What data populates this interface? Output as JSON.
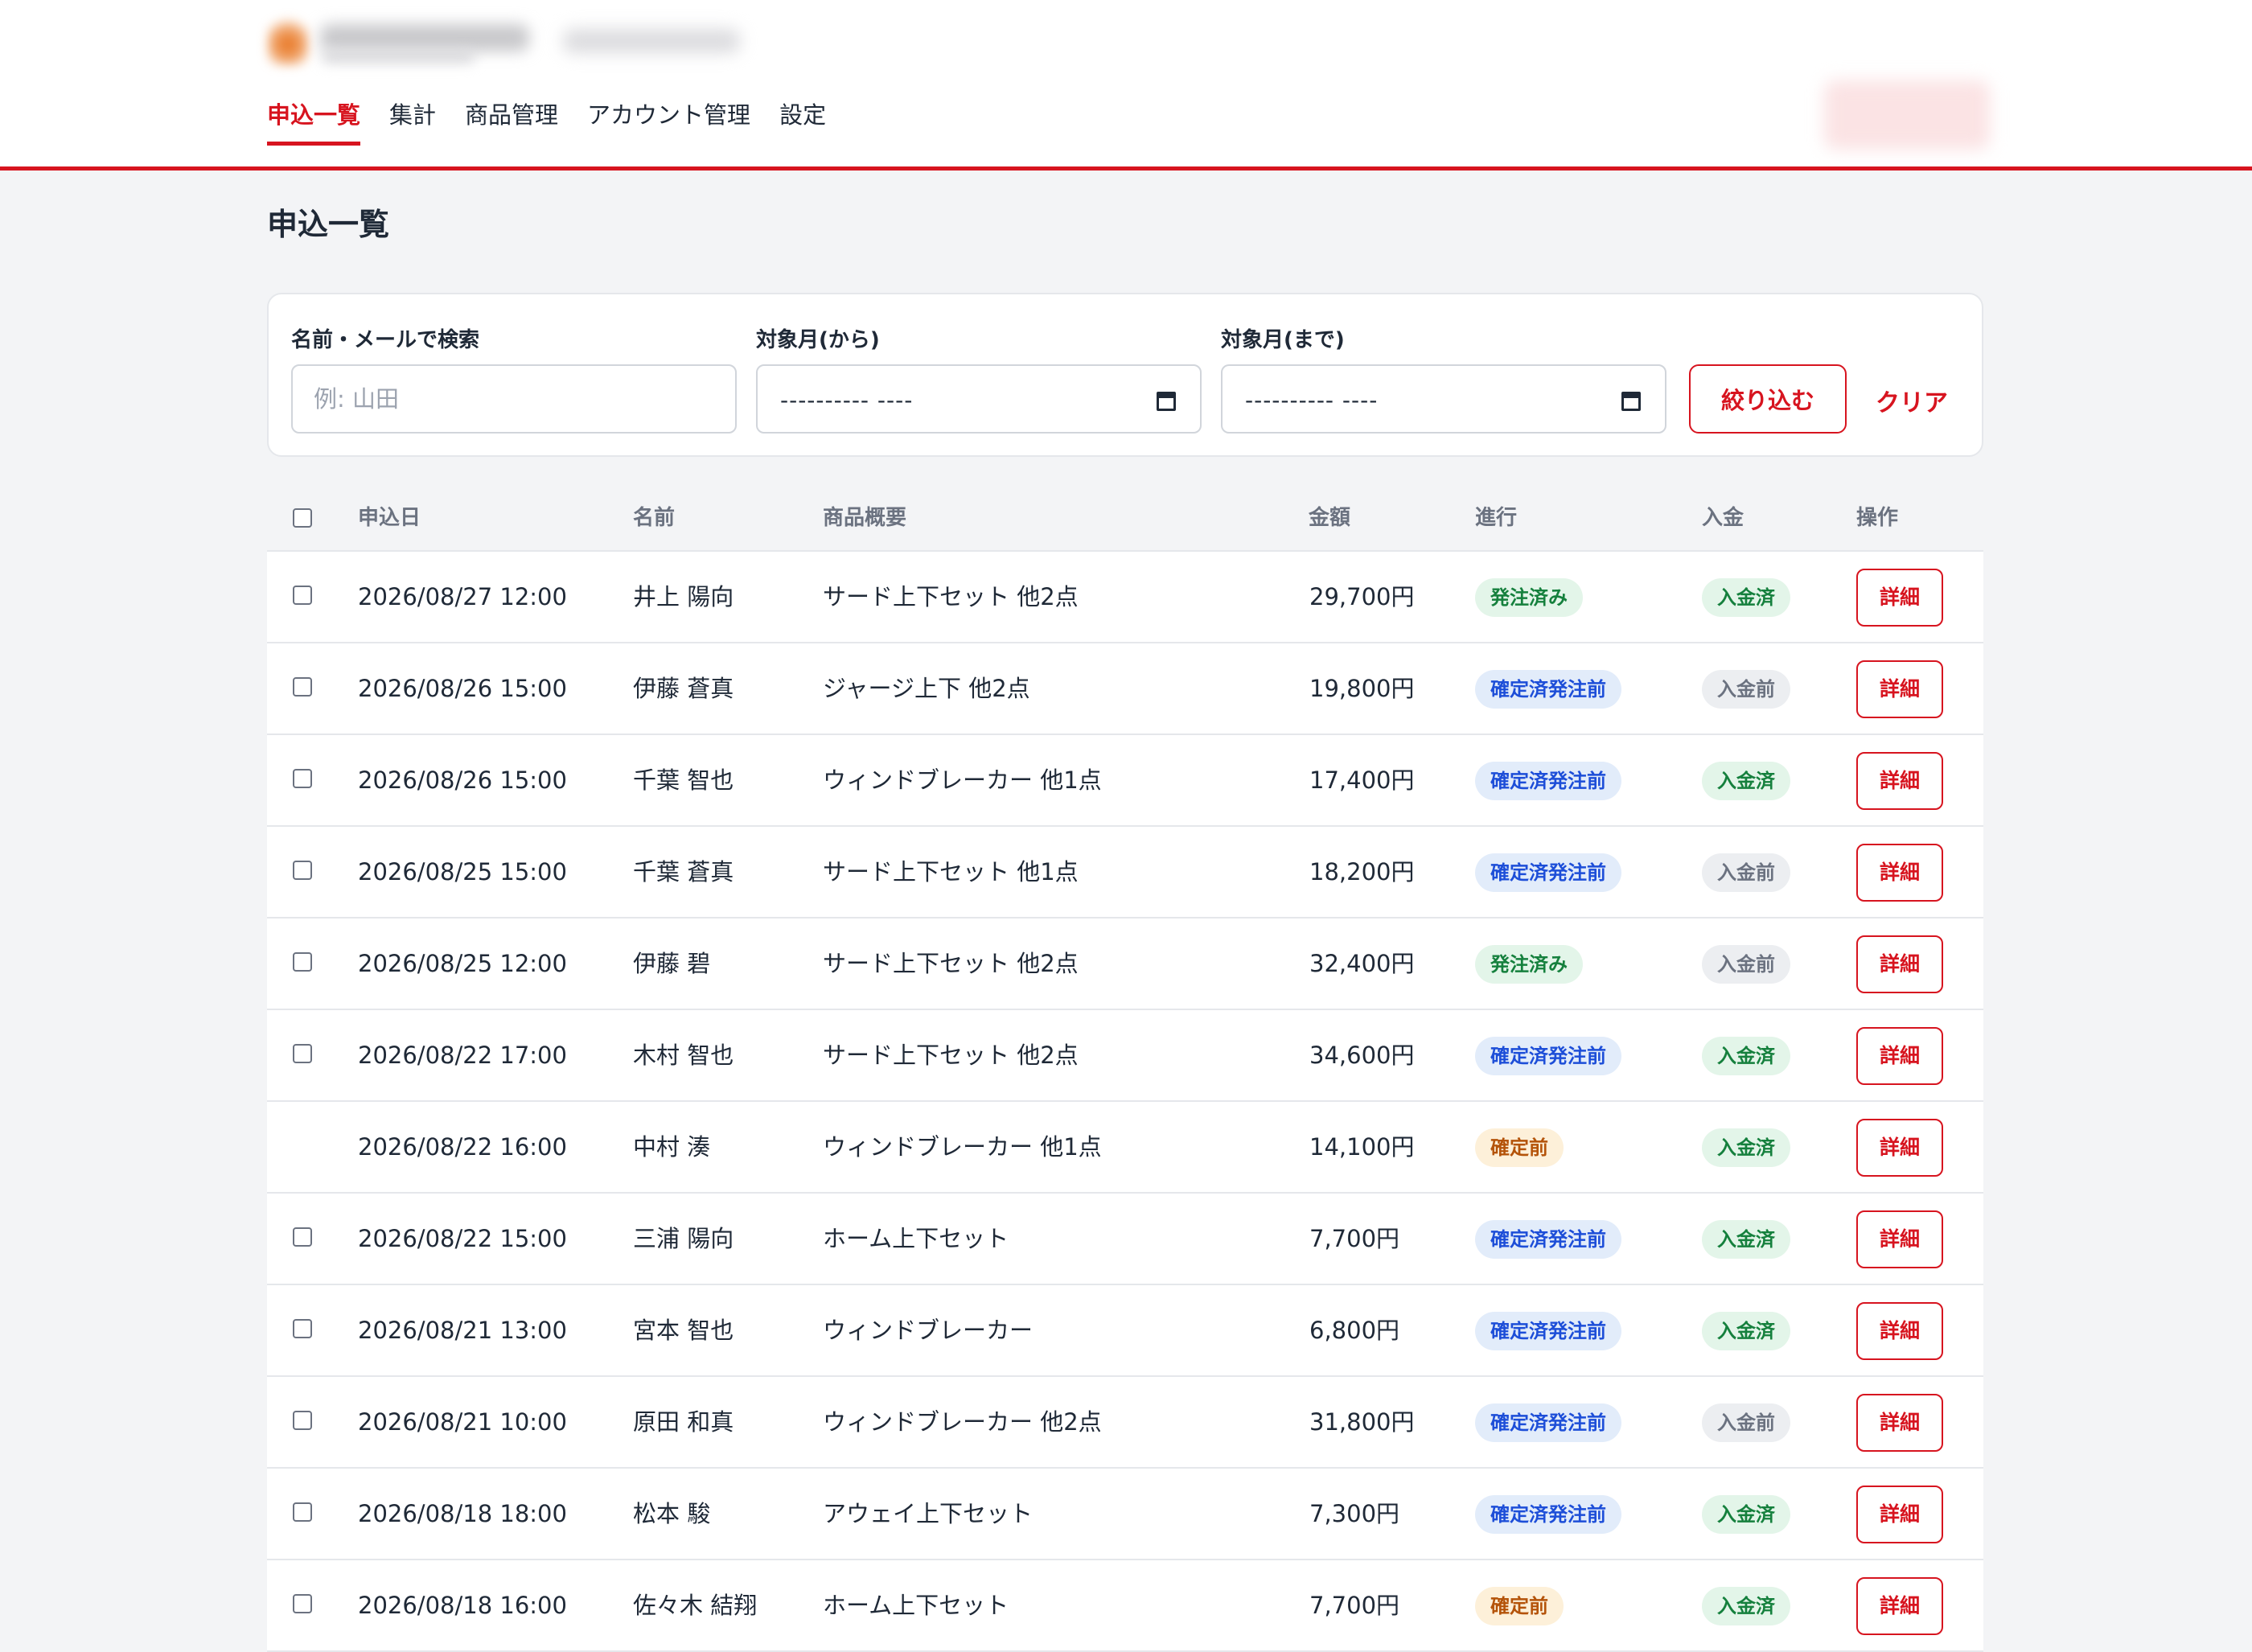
{
  "nav": {
    "items": [
      "申込一覧",
      "集計",
      "商品管理",
      "アカウント管理",
      "設定"
    ],
    "active": 0
  },
  "page": {
    "title": "申込一覧"
  },
  "filter": {
    "search_label": "名前・メールで検索",
    "search_placeholder": "例: 山田",
    "from_label": "対象月(から)",
    "from_value": "---------- ----",
    "to_label": "対象月(まで)",
    "to_value": "---------- ----",
    "apply_label": "絞り込む",
    "clear_label": "クリア"
  },
  "table": {
    "headers": {
      "date": "申込日",
      "name": "名前",
      "summary": "商品概要",
      "amount": "金額",
      "progress": "進行",
      "payment": "入金",
      "action": "操作"
    },
    "detail_label": "詳細",
    "rows": [
      {
        "date": "2026/08/27 12:00",
        "name": "井上 陽向",
        "summary": "サード上下セット 他2点",
        "amount": "29,700円",
        "progress": "発注済み",
        "progress_color": "green",
        "payment": "入金済",
        "payment_color": "green",
        "checkbox": true
      },
      {
        "date": "2026/08/26 15:00",
        "name": "伊藤 蒼真",
        "summary": "ジャージ上下 他2点",
        "amount": "19,800円",
        "progress": "確定済発注前",
        "progress_color": "blue",
        "payment": "入金前",
        "payment_color": "gray",
        "checkbox": true
      },
      {
        "date": "2026/08/26 15:00",
        "name": "千葉 智也",
        "summary": "ウィンドブレーカー 他1点",
        "amount": "17,400円",
        "progress": "確定済発注前",
        "progress_color": "blue",
        "payment": "入金済",
        "payment_color": "green",
        "checkbox": true
      },
      {
        "date": "2026/08/25 15:00",
        "name": "千葉 蒼真",
        "summary": "サード上下セット 他1点",
        "amount": "18,200円",
        "progress": "確定済発注前",
        "progress_color": "blue",
        "payment": "入金前",
        "payment_color": "gray",
        "checkbox": true
      },
      {
        "date": "2026/08/25 12:00",
        "name": "伊藤 碧",
        "summary": "サード上下セット 他2点",
        "amount": "32,400円",
        "progress": "発注済み",
        "progress_color": "green",
        "payment": "入金前",
        "payment_color": "gray",
        "checkbox": true
      },
      {
        "date": "2026/08/22 17:00",
        "name": "木村 智也",
        "summary": "サード上下セット 他2点",
        "amount": "34,600円",
        "progress": "確定済発注前",
        "progress_color": "blue",
        "payment": "入金済",
        "payment_color": "green",
        "checkbox": true
      },
      {
        "date": "2026/08/22 16:00",
        "name": "中村 湊",
        "summary": "ウィンドブレーカー 他1点",
        "amount": "14,100円",
        "progress": "確定前",
        "progress_color": "amber",
        "payment": "入金済",
        "payment_color": "green",
        "checkbox": false
      },
      {
        "date": "2026/08/22 15:00",
        "name": "三浦 陽向",
        "summary": "ホーム上下セット",
        "amount": "7,700円",
        "progress": "確定済発注前",
        "progress_color": "blue",
        "payment": "入金済",
        "payment_color": "green",
        "checkbox": true
      },
      {
        "date": "2026/08/21 13:00",
        "name": "宮本 智也",
        "summary": "ウィンドブレーカー",
        "amount": "6,800円",
        "progress": "確定済発注前",
        "progress_color": "blue",
        "payment": "入金済",
        "payment_color": "green",
        "checkbox": true
      },
      {
        "date": "2026/08/21 10:00",
        "name": "原田 和真",
        "summary": "ウィンドブレーカー 他2点",
        "amount": "31,800円",
        "progress": "確定済発注前",
        "progress_color": "blue",
        "payment": "入金前",
        "payment_color": "gray",
        "checkbox": true
      },
      {
        "date": "2026/08/18 18:00",
        "name": "松本 駿",
        "summary": "アウェイ上下セット",
        "amount": "7,300円",
        "progress": "確定済発注前",
        "progress_color": "blue",
        "payment": "入金済",
        "payment_color": "green",
        "checkbox": true
      },
      {
        "date": "2026/08/18 16:00",
        "name": "佐々木 結翔",
        "summary": "ホーム上下セット",
        "amount": "7,700円",
        "progress": "確定前",
        "progress_color": "amber",
        "payment": "入金済",
        "payment_color": "green",
        "checkbox": true
      }
    ]
  },
  "colors": {
    "accent": "#d7141f",
    "background": "#f3f4f6",
    "badge_green": "#15803d",
    "badge_blue": "#1d4ed8",
    "badge_amber": "#b45309",
    "badge_gray": "#6b7280"
  }
}
